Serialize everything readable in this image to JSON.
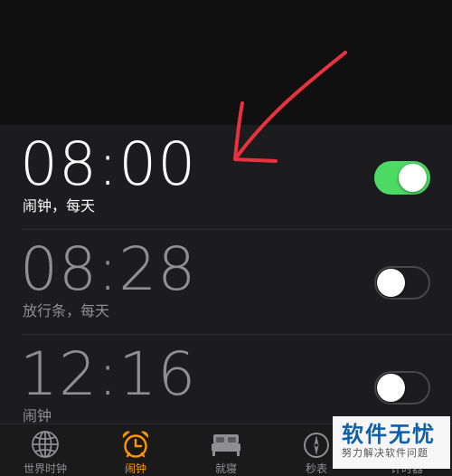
{
  "colors": {
    "toggle_on": "#4cd964",
    "active_tab": "#ff9500",
    "annotation_arrow": "#e8323f",
    "watermark_text": "#0d5fa8"
  },
  "alarms": [
    {
      "time": "08:00",
      "label": "闹钟，每天",
      "enabled": true
    },
    {
      "time": "08:28",
      "label": "放行条，每天",
      "enabled": false
    },
    {
      "time": "12:16",
      "label": "闹钟",
      "enabled": false
    }
  ],
  "tab_bar": {
    "tabs": [
      {
        "label": "世界时钟",
        "icon": "globe-icon",
        "active": false
      },
      {
        "label": "闹钟",
        "icon": "alarm-clock-icon",
        "active": true
      },
      {
        "label": "就寝",
        "icon": "bed-icon",
        "active": false
      },
      {
        "label": "秒表",
        "icon": "stopwatch-icon",
        "active": false
      },
      {
        "label": "计时器",
        "icon": "timer-icon",
        "active": false
      }
    ]
  },
  "watermark": {
    "title": "软件无忧",
    "subtitle": "努力解决软件问题"
  }
}
